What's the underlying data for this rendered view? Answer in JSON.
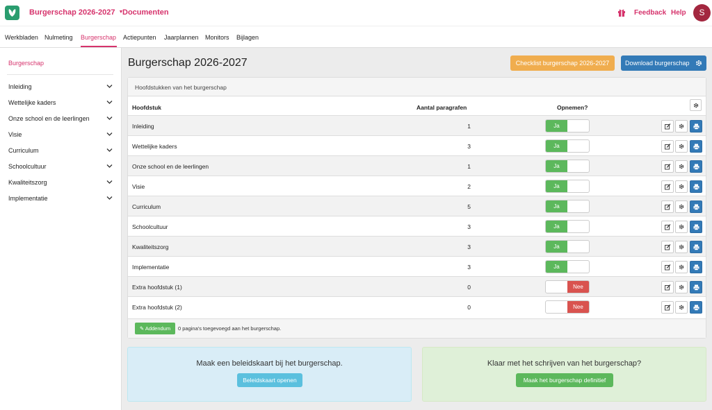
{
  "header": {
    "project": "Burgerschap 2026-2027",
    "documents": "Documenten",
    "feedback": "Feedback",
    "help": "Help",
    "avatar_initial": "S"
  },
  "tabs": [
    {
      "label": "Werkbladen"
    },
    {
      "label": "Nulmeting"
    },
    {
      "label": "Burgerschap"
    },
    {
      "label": "Actiepunten"
    },
    {
      "label": "Jaarplannen"
    },
    {
      "label": "Monitors"
    },
    {
      "label": "Bijlagen"
    }
  ],
  "sidebar": {
    "title": "Burgerschap",
    "items": [
      {
        "label": "Inleiding"
      },
      {
        "label": "Wettelijke kaders"
      },
      {
        "label": "Onze school en de leerlingen"
      },
      {
        "label": "Visie"
      },
      {
        "label": "Curriculum"
      },
      {
        "label": "Schoolcultuur"
      },
      {
        "label": "Kwaliteitszorg"
      },
      {
        "label": "Implementatie"
      }
    ]
  },
  "main": {
    "title": "Burgerschap 2026-2027",
    "checklist_button": "Checklist burgerschap 2026-2027",
    "download_button": "Download burgerschap",
    "panel_title": "Hoofdstukken van het burgerschap",
    "columns": {
      "chapter": "Hoofdstuk",
      "paragraphs": "Aantal paragrafen",
      "include": "Opnemen?"
    },
    "rows": [
      {
        "name": "Inleiding",
        "count": "1",
        "toggle": "Ja"
      },
      {
        "name": "Wettelijke kaders",
        "count": "3",
        "toggle": "Ja"
      },
      {
        "name": "Onze school en de leerlingen",
        "count": "1",
        "toggle": "Ja"
      },
      {
        "name": "Visie",
        "count": "2",
        "toggle": "Ja"
      },
      {
        "name": "Curriculum",
        "count": "5",
        "toggle": "Ja"
      },
      {
        "name": "Schoolcultuur",
        "count": "3",
        "toggle": "Ja"
      },
      {
        "name": "Kwaliteitszorg",
        "count": "3",
        "toggle": "Ja"
      },
      {
        "name": "Implementatie",
        "count": "3",
        "toggle": "Ja"
      },
      {
        "name": "Extra hoofdstuk (1)",
        "count": "0",
        "toggle": "Nee"
      },
      {
        "name": "Extra hoofdstuk (2)",
        "count": "0",
        "toggle": "Nee"
      }
    ],
    "addendum_button": "✎ Addendum",
    "addendum_text": "0 pagina's toegevoegd aan het burgerschap."
  },
  "cards": {
    "policy": {
      "title": "Maak een beleidskaart bij het burgerschap.",
      "button": "Beleidskaart openen"
    },
    "finish": {
      "title": "Klaar met het schrijven van het burgerschap?",
      "button": "Maak het burgerschap definitief"
    }
  },
  "colors": {
    "brand": "#d6336c",
    "primary": "#337ab7",
    "success": "#5cb85c",
    "danger": "#d9534f",
    "warning": "#f0ad4e",
    "info": "#5bc0de"
  }
}
